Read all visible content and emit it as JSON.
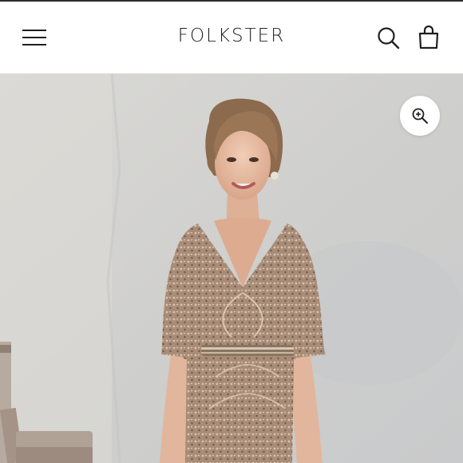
{
  "header": {
    "brand": "FOLKSTER",
    "menu_icon": "hamburger-menu-icon",
    "search_icon": "search-icon",
    "cart_icon": "shopping-bag-icon"
  },
  "product_image": {
    "zoom_icon": "zoom-in-icon"
  },
  "colors": {
    "header_bg": "#ffffff",
    "text": "#222222",
    "wall": "#d4d4d2",
    "dress": "#a88c78"
  }
}
